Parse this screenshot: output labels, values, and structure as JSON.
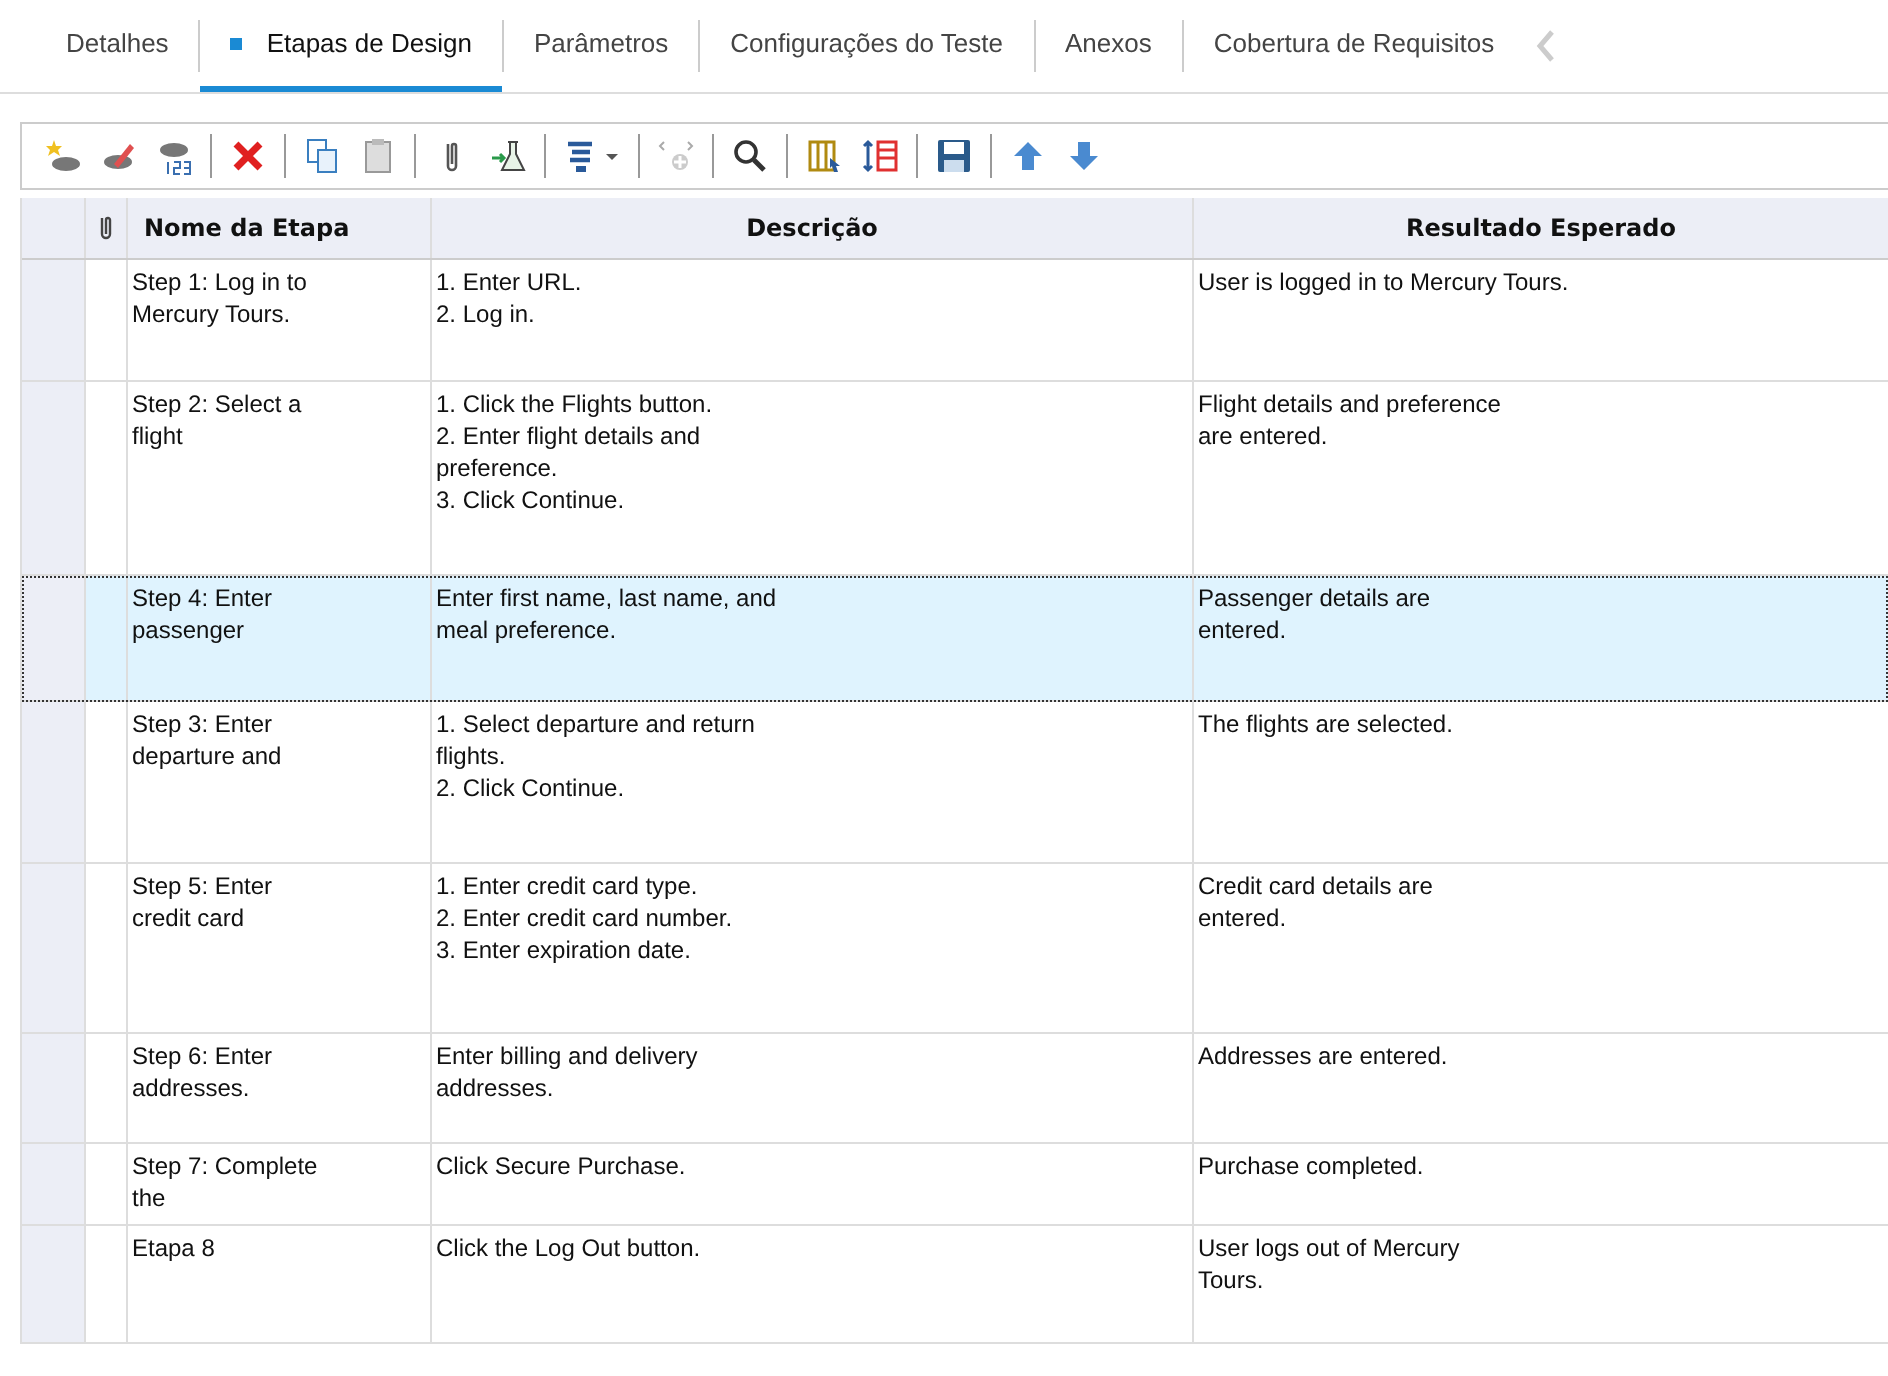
{
  "tabs": [
    {
      "label": "Detalhes",
      "selected": false
    },
    {
      "label": "Etapas de Design",
      "selected": true
    },
    {
      "label": "Parâmetros",
      "selected": false
    },
    {
      "label": "Configurações do Teste",
      "selected": false
    },
    {
      "label": "Anexos",
      "selected": false
    },
    {
      "label": "Cobertura de Requisitos",
      "selected": false
    }
  ],
  "table": {
    "columns": [
      "Nome da Etapa",
      "Descrição",
      "Resultado Esperado"
    ],
    "rows": [
      {
        "selected": false,
        "name": [
          "Step 1: Log in to",
          "Mercury Tours."
        ],
        "description": [
          "1. Enter URL.",
          "2. Log in."
        ],
        "expected": [
          "User is logged in to Mercury Tours."
        ]
      },
      {
        "selected": false,
        "name": [
          "Step 2: Select a",
          "flight"
        ],
        "description": [
          "1. Click the Flights button.",
          "2. Enter flight details and",
          "preference.",
          "3. Click Continue."
        ],
        "expected": [
          "Flight details and preference",
          "are entered."
        ]
      },
      {
        "selected": true,
        "name": [
          "Step 4: Enter",
          "passenger"
        ],
        "description": [
          "Enter first name, last name, and",
          "meal preference."
        ],
        "expected": [
          "Passenger details are",
          "entered."
        ]
      },
      {
        "selected": false,
        "name": [
          "Step 3: Enter",
          "departure and"
        ],
        "description": [
          "1. Select departure and return",
          "flights.",
          "2. Click Continue."
        ],
        "expected": [
          "The flights are selected."
        ]
      },
      {
        "selected": false,
        "name": [
          "Step 5: Enter",
          "credit card"
        ],
        "description": [
          "1. Enter credit card type.",
          "2. Enter credit card number.",
          "3. Enter expiration date."
        ],
        "expected": [
          "Credit card details are",
          "entered."
        ]
      },
      {
        "selected": false,
        "name": [
          "Step 6: Enter",
          "addresses."
        ],
        "description": [
          "Enter billing and delivery",
          "addresses."
        ],
        "expected": [
          "Addresses are entered."
        ]
      },
      {
        "selected": false,
        "name": [
          "Step 7: Complete",
          "the"
        ],
        "description": [
          "Click Secure Purchase."
        ],
        "expected": [
          "Purchase completed."
        ]
      },
      {
        "selected": false,
        "name": [
          "Etapa 8"
        ],
        "description": [
          "Click the Log Out button."
        ],
        "expected": [
          "User logs out of Mercury",
          "Tours."
        ]
      }
    ]
  }
}
